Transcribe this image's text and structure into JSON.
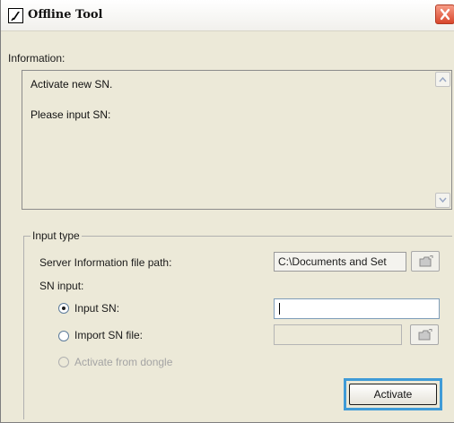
{
  "window": {
    "title": "Offline Tool"
  },
  "information": {
    "label": "Information:",
    "lines": [
      "Activate new SN.",
      "Please input SN:"
    ]
  },
  "input_type": {
    "legend": "Input type",
    "server_path_label": "Server Information file path:",
    "server_path_value": "C:\\Documents and Set",
    "sn_input_label": "SN input:",
    "options": [
      {
        "label": "Input SN:",
        "selected": true,
        "enabled": true
      },
      {
        "label": "Import SN file:",
        "selected": false,
        "enabled": true
      },
      {
        "label": "Activate from dongle",
        "selected": false,
        "enabled": false
      }
    ],
    "sn_value": "",
    "sn_file_value": ""
  },
  "buttons": {
    "activate": "Activate"
  },
  "icons": {
    "app": "app-icon",
    "close": "close-icon",
    "scroll_up": "arrow-up-icon",
    "scroll_down": "arrow-down-icon",
    "browse": "folder-icon"
  },
  "colors": {
    "focus_ring": "#3f9bd7",
    "close_button": "#d8462c"
  }
}
